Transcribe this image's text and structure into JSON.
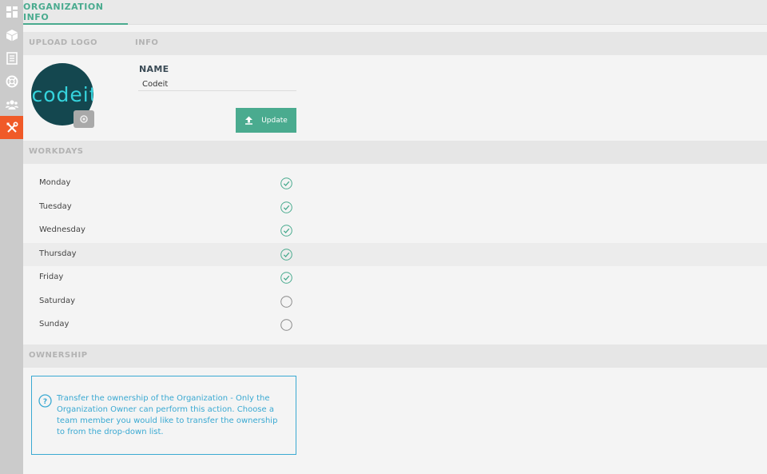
{
  "sidebar": {
    "items": [
      {
        "icon": "dashboard-icon"
      },
      {
        "icon": "cube-icon"
      },
      {
        "icon": "document-list-icon"
      },
      {
        "icon": "lifebuoy-icon"
      },
      {
        "icon": "team-icon"
      },
      {
        "icon": "tools-icon",
        "active": true
      }
    ],
    "active_color": "#f05a28"
  },
  "tabs": [
    {
      "label": "ORGANIZATION INFO",
      "active": true
    }
  ],
  "sections": {
    "upload_logo": "UPLOAD LOGO",
    "info": "INFO",
    "workdays": "WORKDAYS",
    "ownership": "OWNERSHIP"
  },
  "logo": {
    "text": "codeit"
  },
  "info": {
    "name_label": "NAME",
    "name_value": "Codeit",
    "update_label": "Update"
  },
  "workdays": [
    {
      "day": "Monday",
      "checked": true
    },
    {
      "day": "Tuesday",
      "checked": true
    },
    {
      "day": "Wednesday",
      "checked": true
    },
    {
      "day": "Thursday",
      "checked": true
    },
    {
      "day": "Friday",
      "checked": true
    },
    {
      "day": "Saturday",
      "checked": false
    },
    {
      "day": "Sunday",
      "checked": false
    }
  ],
  "ownership": {
    "message": "Transfer the ownership of the Organization - Only the Organization Owner can perform this action. Choose a team member you would like to transfer the ownership to from the drop-down list."
  },
  "colors": {
    "accent": "#4aab8f",
    "info": "#3aa9d2"
  }
}
